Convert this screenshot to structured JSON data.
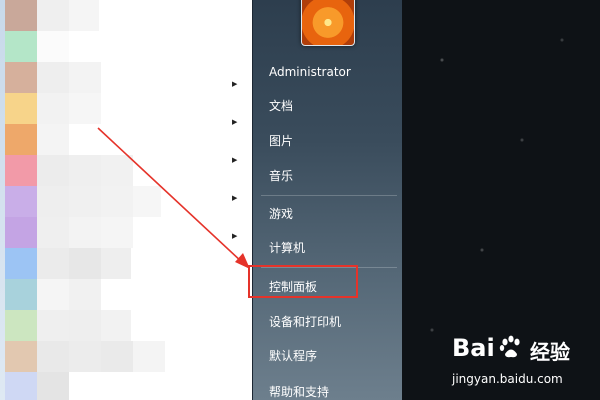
{
  "start_menu": {
    "user_name": "Administrator",
    "items": [
      {
        "label": "文档"
      },
      {
        "label": "图片"
      },
      {
        "label": "音乐"
      },
      {
        "label": "游戏"
      },
      {
        "label": "计算机"
      },
      {
        "label": "控制面板"
      },
      {
        "label": "设备和打印机"
      },
      {
        "label": "默认程序"
      },
      {
        "label": "帮助和支持"
      }
    ]
  },
  "annotation": {
    "color": "#e5332a"
  },
  "watermark": {
    "logo_text": "Bai",
    "logo_suffix": "经验",
    "url": "jingyan.baidu.com"
  }
}
